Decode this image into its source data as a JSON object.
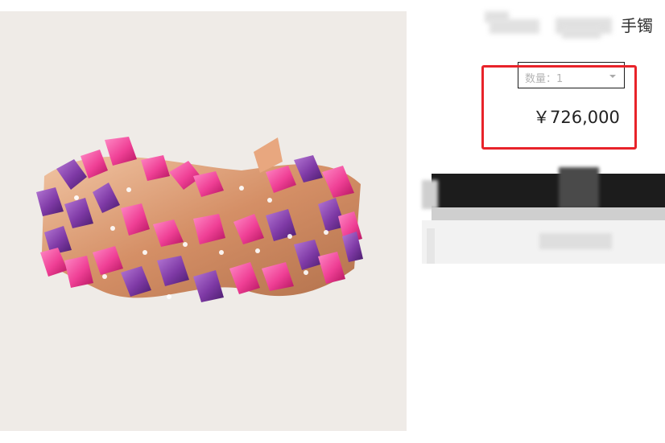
{
  "product": {
    "title": "手镯",
    "price": "￥726,000",
    "quantity_label": "数量：1"
  },
  "image": {
    "description_icon": "bracelet-image",
    "background_color": "#efebe7",
    "gem_colors": [
      "#8b3fb0",
      "#f03e92",
      "#d99a73"
    ]
  },
  "highlight": {
    "color": "#e8232a"
  }
}
